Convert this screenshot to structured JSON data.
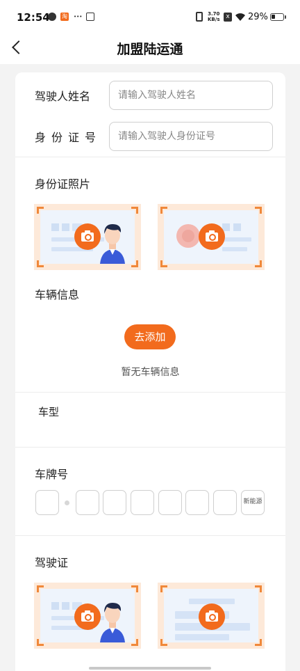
{
  "status_bar": {
    "time": "12:54",
    "net_speed_value": "3.70",
    "net_speed_unit": "KB/s",
    "battery": "29%"
  },
  "header": {
    "title": "加盟陆运通"
  },
  "form": {
    "driver_name": {
      "label": "驾驶人姓名",
      "placeholder": "请输入驾驶人姓名",
      "value": ""
    },
    "id_number": {
      "label": "身份证号",
      "placeholder": "请输入驾驶人身份证号",
      "value": ""
    }
  },
  "sections": {
    "id_photo_title": "身份证照片",
    "vehicle_info_title": "车辆信息",
    "add_button": "去添加",
    "no_vehicle_text": "暂无车辆信息",
    "vehicle_type_label": "车型",
    "plate_number_title": "车牌号",
    "new_energy_label": "新能源",
    "driver_license_title": "驾驶证"
  },
  "colors": {
    "accent": "#f26b1d",
    "photo_frame": "#fde9d9",
    "photo_bg": "#eef4fc"
  }
}
